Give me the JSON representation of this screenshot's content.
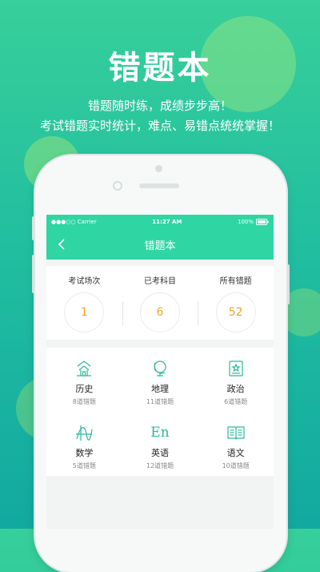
{
  "promo": {
    "title": "错题本",
    "line1": "错题随时练，成绩步步高！",
    "line2": "考试错题实时统计，难点、易错点统统掌握！"
  },
  "statusbar": {
    "carrier": "●●●○○ Carrier",
    "time": "11:27 AM",
    "battery": "100%"
  },
  "navbar": {
    "title": "错题本"
  },
  "stats": [
    {
      "label": "考试场次",
      "value": "1"
    },
    {
      "label": "已考科目",
      "value": "6"
    },
    {
      "label": "所有错题",
      "value": "52"
    }
  ],
  "subjects": [
    {
      "name": "历史",
      "count": "8道错题",
      "icon": "history-icon"
    },
    {
      "name": "地理",
      "count": "11道错题",
      "icon": "globe-icon"
    },
    {
      "name": "政治",
      "count": "6道错题",
      "icon": "emblem-icon"
    },
    {
      "name": "数学",
      "count": "5道错题",
      "icon": "math-icon"
    },
    {
      "name": "英语",
      "count": "12道错题",
      "icon": "english-icon",
      "glyph": "En"
    },
    {
      "name": "语文",
      "count": "10道错题",
      "icon": "book-icon"
    }
  ],
  "colors": {
    "accent": "#2fd6a3",
    "number": "#f0a526",
    "icon": "#2db89a"
  }
}
